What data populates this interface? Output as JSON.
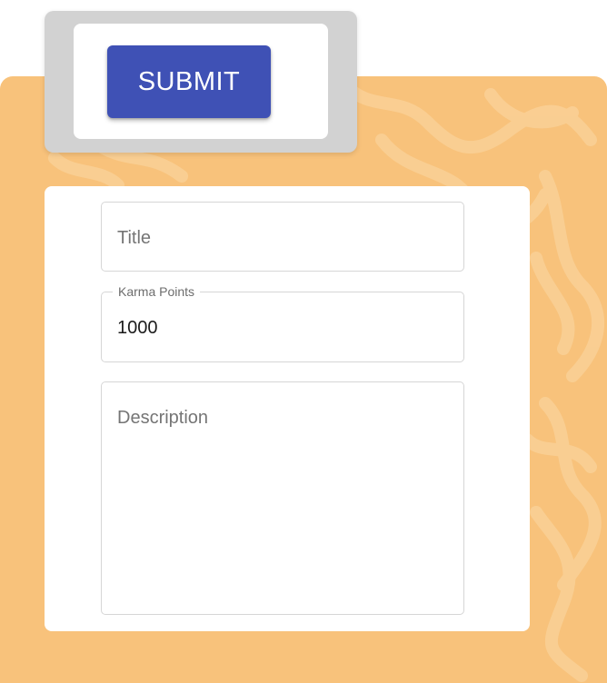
{
  "toolbar": {
    "submit_label": "SUBMIT"
  },
  "form": {
    "title": {
      "placeholder": "Title",
      "value": ""
    },
    "karma": {
      "label": "Karma Points",
      "value": "1000"
    },
    "description": {
      "placeholder": "Description",
      "value": ""
    }
  },
  "colors": {
    "background_panel": "#f8c27b",
    "submit_button": "#3f51b5",
    "frame": "#d2d2d2",
    "card": "#ffffff"
  }
}
